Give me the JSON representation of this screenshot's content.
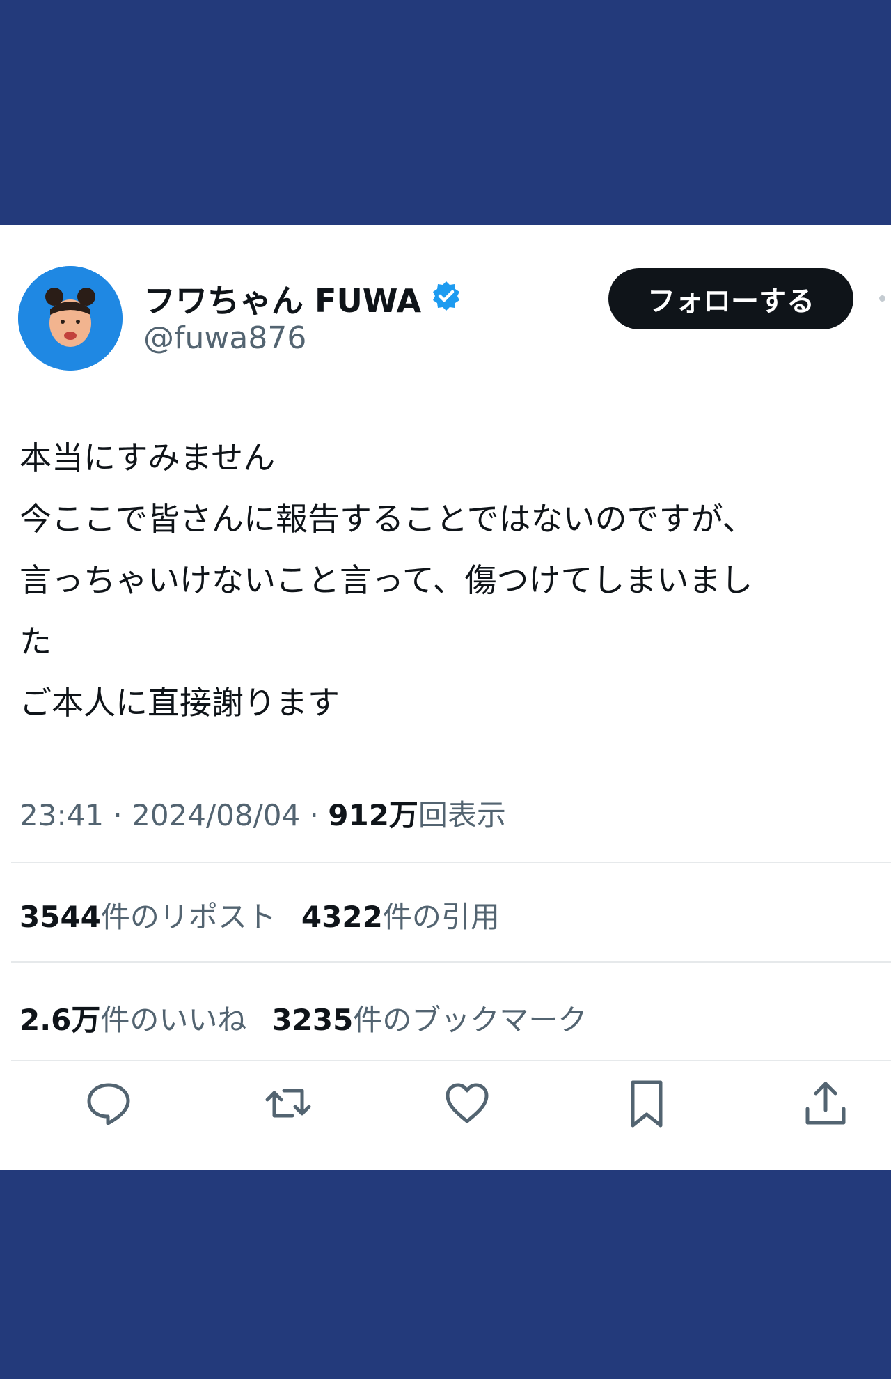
{
  "tweet": {
    "author": {
      "display_name": "フワちゃん FUWA",
      "handle": "@fuwa876",
      "verified_icon": "verified-badge-icon",
      "avatar": "avatar-photo"
    },
    "follow_label": "フォローする",
    "text_lines": [
      "本当にすみません",
      "今ここで皆さんに報告することではないのですが、",
      "言っちゃいけないこと言って、傷つけてしまいまし",
      "た",
      "ご本人に直接謝ります"
    ],
    "meta": {
      "time": "23:41",
      "sep1": " · ",
      "date": "2024/08/04",
      "sep2": " · ",
      "views_count": "912万",
      "views_label": "回表示"
    },
    "stats": {
      "reposts_count": "3544",
      "reposts_label": "件のリポスト",
      "quotes_count": "4322",
      "quotes_label": "件の引用",
      "likes_count": "2.6万",
      "likes_label": "件のいいね",
      "bookmarks_count": "3235",
      "bookmarks_label": "件のブックマーク"
    },
    "actions": [
      "reply-icon",
      "retweet-icon",
      "like-icon",
      "bookmark-icon",
      "share-icon"
    ]
  },
  "colors": {
    "background": "#233a7b",
    "card": "#ffffff",
    "text": "#0f1419",
    "secondary": "#536471",
    "avatar_bg": "#1f88e3",
    "verified": "#1d9bf0"
  }
}
